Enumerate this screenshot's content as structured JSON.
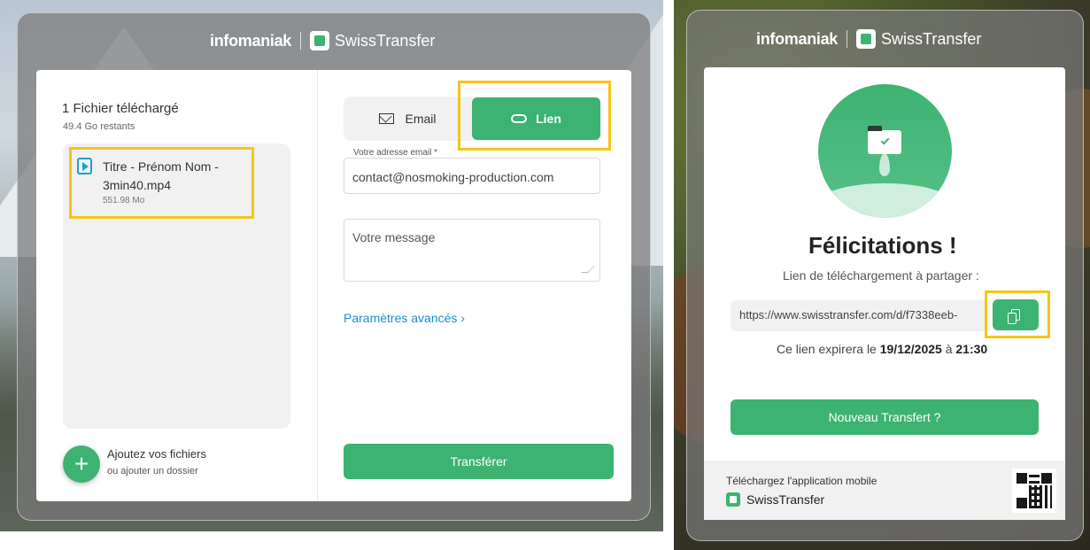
{
  "left": {
    "brand": {
      "infomaniak": "infomaniak",
      "app": "SwissTransfer"
    },
    "files": {
      "title": "1 Fichier téléchargé",
      "remaining": "49.4 Go restants",
      "items": [
        {
          "name": "Titre - Prénom Nom - 3min40.mp4",
          "size": "551.98 Mo",
          "icon": "video-file-icon"
        }
      ]
    },
    "add": {
      "label": "Ajoutez vos fichiers",
      "sub": "ou ajouter un dossier",
      "icon": "plus-icon"
    },
    "toggle": {
      "email_label": "Email",
      "link_label": "Lien",
      "selected": "Lien"
    },
    "email_field": {
      "label": "Votre adresse email *",
      "value": "contact@nosmoking-production.com"
    },
    "message_field": {
      "placeholder": "Votre message"
    },
    "advanced_link": "Paramètres avancés",
    "transfer_button": "Transférer"
  },
  "right": {
    "brand": {
      "infomaniak": "infomaniak",
      "app": "SwissTransfer"
    },
    "title": "Félicitations !",
    "share_label": "Lien de téléchargement à partager :",
    "link_value": "https://www.swisstransfer.com/d/f7338eeb-",
    "expires_prefix": "Ce lien expirera le",
    "expires_date": "19/12/2025",
    "expires_mid": "à",
    "expires_time": "21:30",
    "new_transfer_button": "Nouveau Transfert ?",
    "app_download_label": "Téléchargez l'application mobile",
    "app_name": "SwissTransfer"
  },
  "colors": {
    "accent": "#3cb371",
    "highlight": "#f5c518",
    "link": "#1a8fd1"
  }
}
